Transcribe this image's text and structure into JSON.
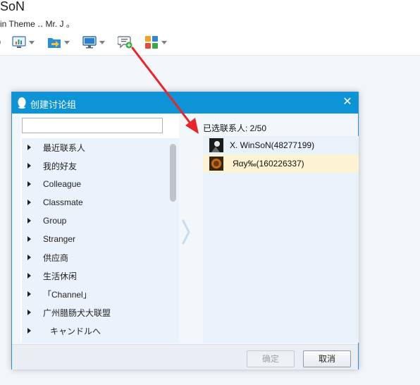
{
  "background_app": {
    "title": "SoN",
    "signature": "in Theme ‥  Mr. J 。",
    "toolbar": [
      {
        "icon": "whiteboard-icon"
      },
      {
        "icon": "file-transfer-icon"
      },
      {
        "icon": "remote-desktop-icon"
      },
      {
        "icon": "create-discussion-icon"
      },
      {
        "icon": "app-grid-icon"
      }
    ]
  },
  "dialog": {
    "title": "创建讨论组",
    "close": "✕",
    "search": {
      "value": "",
      "placeholder": ""
    },
    "groups": [
      "最近联系人",
      "我的好友",
      "Colleague",
      "Classmate",
      "Group",
      "Stranger",
      "供应商",
      "生活休闲",
      "「Channel」",
      "广州腊肠犬大联盟",
      "キャンドルへ"
    ],
    "move_arrow": "›",
    "selected_label": "已选联系人: 2/50",
    "selected": [
      {
        "name": "X. WinSoN(48277199)",
        "highlight": false
      },
      {
        "name": "Яαу‰(160226337)",
        "highlight": true
      }
    ],
    "buttons": {
      "ok": "确定",
      "cancel": "取消"
    }
  },
  "colors": {
    "titlebar": "#0d94d6",
    "annotation_arrow": "#e8262a",
    "list_background": "#eaf3fb",
    "highlight_row": "#fdf3d2"
  }
}
